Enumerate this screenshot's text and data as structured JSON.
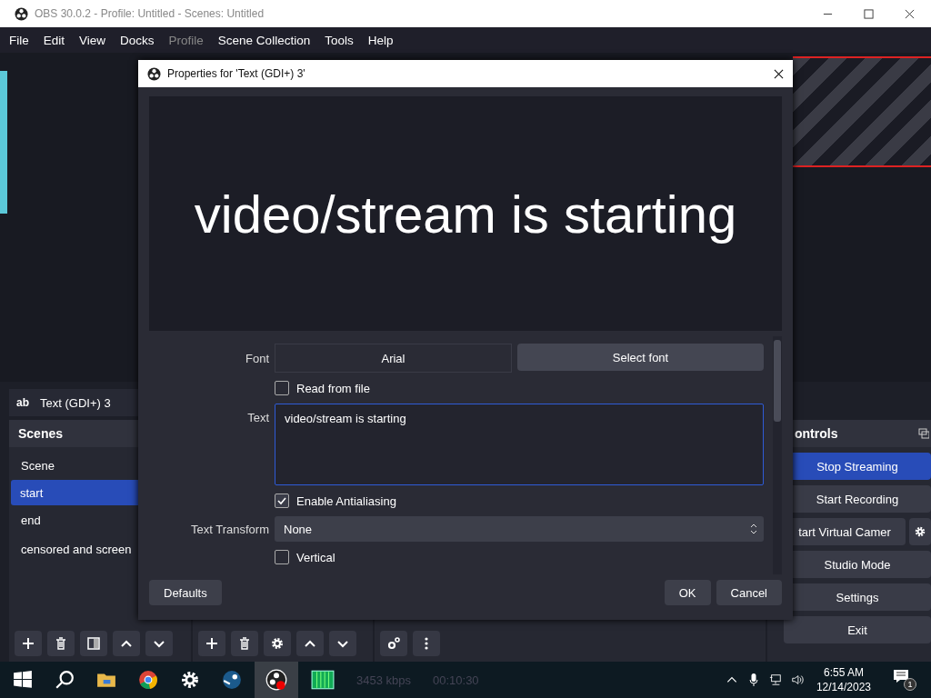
{
  "window": {
    "title": "OBS 30.0.2 - Profile: Untitled - Scenes: Untitled"
  },
  "menu": [
    {
      "label": "File",
      "disabled": false
    },
    {
      "label": "Edit",
      "disabled": false
    },
    {
      "label": "View",
      "disabled": false
    },
    {
      "label": "Docks",
      "disabled": false
    },
    {
      "label": "Profile",
      "disabled": true
    },
    {
      "label": "Scene Collection",
      "disabled": false
    },
    {
      "label": "Tools",
      "disabled": false
    },
    {
      "label": "Help",
      "disabled": false
    }
  ],
  "source": {
    "icon_text": "ab",
    "label": "Text (GDI+) 3"
  },
  "scenes": {
    "title": "Scenes",
    "items": [
      {
        "label": "Scene",
        "selected": false
      },
      {
        "label": "start",
        "selected": true
      },
      {
        "label": "end",
        "selected": false
      },
      {
        "label": "censored and screen",
        "selected": false
      }
    ]
  },
  "controls": {
    "title": "ontrols",
    "buttons": [
      {
        "label": "Stop Streaming",
        "active": true,
        "gear": false
      },
      {
        "label": "Start Recording",
        "active": false,
        "gear": false
      },
      {
        "label": "tart Virtual Camer",
        "active": false,
        "gear": true
      },
      {
        "label": "Studio Mode",
        "active": false,
        "gear": false
      },
      {
        "label": "Settings",
        "active": false,
        "gear": false
      },
      {
        "label": "Exit",
        "active": false,
        "gear": false
      }
    ]
  },
  "dialog": {
    "title": "Properties for 'Text (GDI+) 3'",
    "preview_text": "video/stream is starting",
    "fields": [
      {
        "kind": "font",
        "label": "Font",
        "value": "Arial",
        "button": "Select font"
      },
      {
        "kind": "checkbox",
        "label": "Read from file",
        "checked": false
      },
      {
        "kind": "textarea",
        "label": "Text",
        "value": "video/stream is starting"
      },
      {
        "kind": "checkbox",
        "label": "Enable Antialiasing",
        "checked": true
      },
      {
        "kind": "select",
        "label": "Text Transform",
        "value": "None"
      },
      {
        "kind": "checkbox",
        "label": "Vertical",
        "checked": false
      }
    ],
    "buttons": [
      {
        "label": "Defaults",
        "kind": "left"
      },
      {
        "label": "OK",
        "kind": "right"
      },
      {
        "label": "Cancel",
        "kind": "right"
      }
    ]
  },
  "taskbar": {
    "status": [
      "3453 kbps",
      "00:10:30"
    ],
    "time": "6:55 AM",
    "date": "12/14/2023",
    "notifications": "1"
  }
}
